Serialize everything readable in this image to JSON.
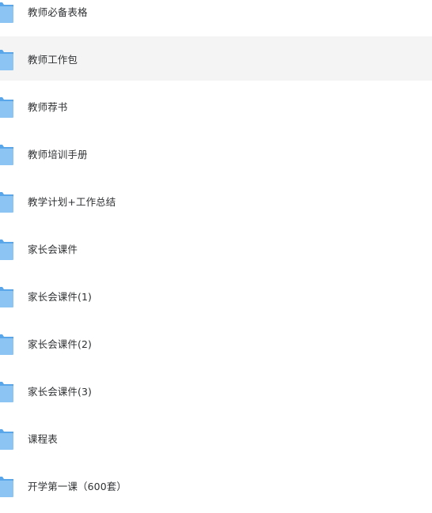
{
  "colors": {
    "folder_front": "#8cc4f4",
    "folder_back": "#5aa6ea",
    "hover_row": "#f4f4f5",
    "text": "#2f3133"
  },
  "files": [
    {
      "name": "教师必备表格",
      "icon": "folder-icon"
    },
    {
      "name": "教师工作包",
      "icon": "folder-icon",
      "hovered": true
    },
    {
      "name": "教师荐书",
      "icon": "folder-icon"
    },
    {
      "name": "教师培训手册",
      "icon": "folder-icon"
    },
    {
      "name": "教学计划+工作总结",
      "icon": "folder-icon"
    },
    {
      "name": "家长会课件",
      "icon": "folder-icon"
    },
    {
      "name": "家长会课件(1)",
      "icon": "folder-icon"
    },
    {
      "name": "家长会课件(2)",
      "icon": "folder-icon"
    },
    {
      "name": "家长会课件(3)",
      "icon": "folder-icon"
    },
    {
      "name": "课程表",
      "icon": "folder-icon"
    },
    {
      "name": "开学第一课（600套）",
      "icon": "folder-icon"
    }
  ]
}
